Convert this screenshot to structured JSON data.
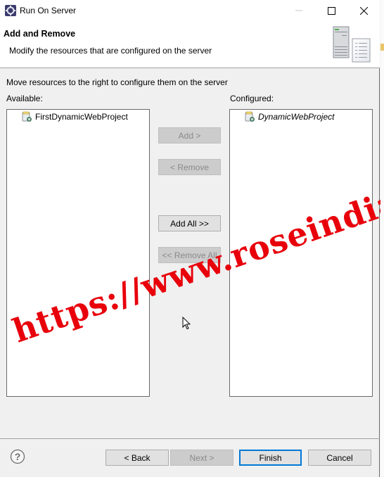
{
  "window": {
    "title": "Run On Server",
    "controls": {
      "minimize": "minimize",
      "maximize": "maximize",
      "close": "close"
    }
  },
  "banner": {
    "title": "Add and Remove",
    "description": "Modify the resources that are configured on the server",
    "icon": "server-config-icon"
  },
  "content": {
    "instructions": "Move resources to the right to configure them on the server",
    "available": {
      "label": "Available:",
      "items": [
        {
          "name": "FirstDynamicWebProject",
          "icon": "web-project-icon"
        }
      ]
    },
    "configured": {
      "label": "Configured:",
      "items": [
        {
          "name": "DynamicWebProject",
          "icon": "web-project-icon",
          "italic": true
        }
      ]
    },
    "buttons": {
      "add": {
        "label": "Add >",
        "enabled": false
      },
      "remove": {
        "label": "< Remove",
        "enabled": false
      },
      "add_all": {
        "label": "Add All >>",
        "enabled": true
      },
      "remove_all": {
        "label": "<< Remove All",
        "enabled": false
      }
    }
  },
  "footer": {
    "help_icon": "help-icon",
    "back": {
      "label": "< Back",
      "enabled": true
    },
    "next": {
      "label": "Next >",
      "enabled": false
    },
    "finish": {
      "label": "Finish",
      "enabled": true,
      "default": true
    },
    "cancel": {
      "label": "Cancel",
      "enabled": true
    }
  },
  "watermark": {
    "text": "https://www.roseindia.net",
    "color": "#e8000b"
  },
  "colors": {
    "focus_border": "#0078d7",
    "window_bg": "#f0f0f0"
  }
}
